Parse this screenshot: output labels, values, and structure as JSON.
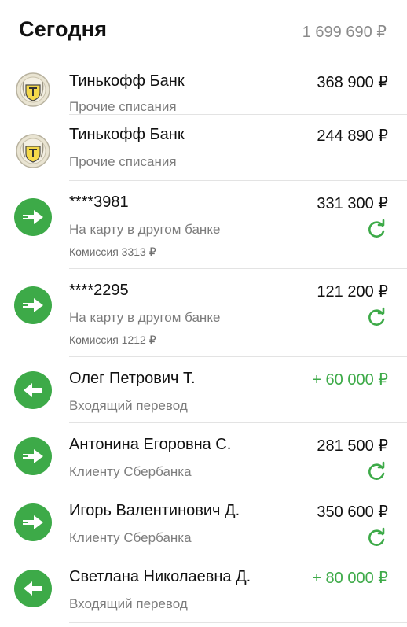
{
  "header": {
    "title": "Сегодня",
    "total": "1 699 690 ₽"
  },
  "colors": {
    "accent": "#3daa48",
    "muted": "#7d7d7d",
    "divider": "#e3e3e3"
  },
  "transactions": [
    {
      "name": "Тинькофф Банк",
      "subtitle": "Прочие списания",
      "amount": "368 900 ₽",
      "icon": "tinkoff-logo-icon"
    },
    {
      "name": "Тинькофф Банк",
      "subtitle": "Прочие списания",
      "amount": "244 890 ₽",
      "icon": "tinkoff-logo-icon"
    },
    {
      "name": "****3981",
      "subtitle": "На карту в другом банке",
      "fee": "Комиссия 3313 ₽",
      "amount": "331 300 ₽",
      "icon": "outgoing-arrow-icon",
      "repeat_icon": "repeat-icon"
    },
    {
      "name": "****2295",
      "subtitle": "На карту в другом банке",
      "fee": "Комиссия 1212 ₽",
      "amount": "121 200 ₽",
      "icon": "outgoing-arrow-icon",
      "repeat_icon": "repeat-icon"
    },
    {
      "name": "Олег Петрович Т.",
      "subtitle": "Входящий перевод",
      "amount": "+ 60 000 ₽",
      "icon": "incoming-arrow-icon"
    },
    {
      "name": "Антонина Егоровна С.",
      "subtitle": "Клиенту Сбербанка",
      "amount": "281 500 ₽",
      "icon": "outgoing-arrow-icon",
      "repeat_icon": "repeat-icon"
    },
    {
      "name": "Игорь Валентинович Д.",
      "subtitle": "Клиенту Сбербанка",
      "amount": "350 600 ₽",
      "icon": "outgoing-arrow-icon",
      "repeat_icon": "repeat-icon"
    },
    {
      "name": "Светлана Николаевна Д.",
      "subtitle": "Входящий перевод",
      "amount": "+ 80 000 ₽",
      "icon": "incoming-arrow-icon"
    }
  ]
}
